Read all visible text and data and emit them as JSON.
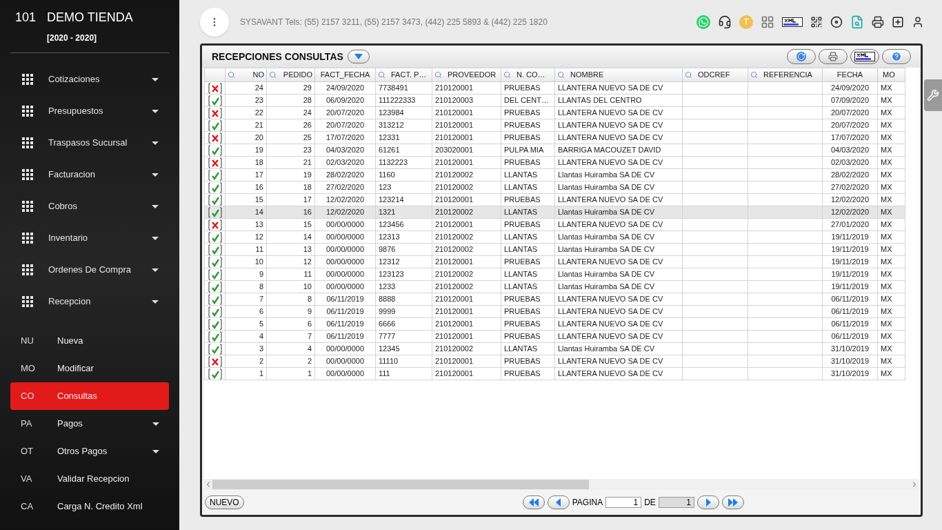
{
  "company": {
    "number": "101",
    "name": "DEMO TIENDA",
    "period": "[2020 - 2020]"
  },
  "menu": [
    {
      "label": "Cotizaciones"
    },
    {
      "label": "Presupuestos"
    },
    {
      "label": "Traspasos Sucursal"
    },
    {
      "label": "Facturacion"
    },
    {
      "label": "Cobros"
    },
    {
      "label": "Inventario"
    },
    {
      "label": "Ordenes De Compra"
    },
    {
      "label": "Recepcion"
    }
  ],
  "submenu": [
    {
      "abbr": "NU",
      "label": "Nueva",
      "selected": false,
      "has_caret": false
    },
    {
      "abbr": "MO",
      "label": "Modificar",
      "selected": false,
      "has_caret": false
    },
    {
      "abbr": "CO",
      "label": "Consultas",
      "selected": true,
      "has_caret": false
    },
    {
      "abbr": "PA",
      "label": "Pagos",
      "selected": false,
      "has_caret": true
    },
    {
      "abbr": "OT",
      "label": "Otros Pagos",
      "selected": false,
      "has_caret": true
    },
    {
      "abbr": "VA",
      "label": "Validar Recepcion",
      "selected": false,
      "has_caret": false
    },
    {
      "abbr": "CA",
      "label": "Carga N. Credito Xml",
      "selected": false,
      "has_caret": false
    }
  ],
  "topbar": {
    "contact": "SYSAVANT Tels: (55) 2157 3211, (55) 2157 3473, (442) 225 5893 & (442) 225 1820",
    "user_initial": "T"
  },
  "panel": {
    "title": "RECEPCIONES CONSULTAS"
  },
  "table": {
    "columns": [
      {
        "label": "NO",
        "filterable": true
      },
      {
        "label": "PEDIDO",
        "filterable": true
      },
      {
        "label": "FACT_FECHA",
        "filterable": false
      },
      {
        "label": "FACT. P…",
        "filterable": true
      },
      {
        "label": "PROVEEDOR",
        "filterable": true
      },
      {
        "label": "N. CO…",
        "filterable": true
      },
      {
        "label": "NOMBRE",
        "filterable": true
      },
      {
        "label": "ODCREF",
        "filterable": true
      },
      {
        "label": "REFERENCIA",
        "filterable": true
      },
      {
        "label": "FECHA",
        "filterable": false
      },
      {
        "label": "MO",
        "filterable": false
      }
    ],
    "rows": [
      {
        "kind": "cancel",
        "selected": false,
        "cells": [
          "24",
          "29",
          "24/09/2020",
          "7738491",
          "210120001",
          "PRUEBAS",
          "LLANTERA NUEVO SA DE CV",
          "",
          "",
          "24/09/2020",
          "MX"
        ]
      },
      {
        "kind": "ok",
        "selected": false,
        "cells": [
          "23",
          "28",
          "06/09/2020",
          "111222333",
          "210120003",
          "DEL CENT…",
          "LLANTAS DEL CENTRO",
          "",
          "",
          "07/09/2020",
          "MX"
        ]
      },
      {
        "kind": "cancel",
        "selected": false,
        "cells": [
          "22",
          "24",
          "20/07/2020",
          "123984",
          "210120001",
          "PRUEBAS",
          "LLANTERA NUEVO SA DE CV",
          "",
          "",
          "20/07/2020",
          "MX"
        ]
      },
      {
        "kind": "ok",
        "selected": false,
        "cells": [
          "21",
          "26",
          "20/07/2020",
          "313212",
          "210120001",
          "PRUEBAS",
          "LLANTERA NUEVO SA DE CV",
          "",
          "",
          "20/07/2020",
          "MX"
        ]
      },
      {
        "kind": "cancel",
        "selected": false,
        "cells": [
          "20",
          "25",
          "17/07/2020",
          "12331",
          "210120001",
          "PRUEBAS",
          "LLANTERA NUEVO SA DE CV",
          "",
          "",
          "17/07/2020",
          "MX"
        ]
      },
      {
        "kind": "ok",
        "selected": false,
        "cells": [
          "19",
          "23",
          "04/03/2020",
          "61261",
          "203020001",
          "PULPA MIA",
          "BARRIGA MACOUZET DAVID",
          "",
          "",
          "04/03/2020",
          "MX"
        ]
      },
      {
        "kind": "cancel",
        "selected": false,
        "cells": [
          "18",
          "21",
          "02/03/2020",
          "1132223",
          "210120001",
          "PRUEBAS",
          "LLANTERA NUEVO SA DE CV",
          "",
          "",
          "02/03/2020",
          "MX"
        ]
      },
      {
        "kind": "ok",
        "selected": false,
        "cells": [
          "17",
          "19",
          "28/02/2020",
          "1160",
          "210120002",
          "LLANTAS",
          "Llantas Huiramba SA DE CV",
          "",
          "",
          "28/02/2020",
          "MX"
        ]
      },
      {
        "kind": "ok",
        "selected": false,
        "cells": [
          "16",
          "18",
          "27/02/2020",
          "123",
          "210120002",
          "LLANTAS",
          "Llantas Huiramba SA DE CV",
          "",
          "",
          "27/02/2020",
          "MX"
        ]
      },
      {
        "kind": "ok",
        "selected": false,
        "cells": [
          "15",
          "17",
          "12/02/2020",
          "123214",
          "210120001",
          "PRUEBAS",
          "LLANTERA NUEVO SA DE CV",
          "",
          "",
          "12/02/2020",
          "MX"
        ]
      },
      {
        "kind": "ok",
        "selected": true,
        "cells": [
          "14",
          "16",
          "12/02/2020",
          "1321",
          "210120002",
          "LLANTAS",
          "Llantas Huiramba SA DE CV",
          "",
          "",
          "12/02/2020",
          "MX"
        ]
      },
      {
        "kind": "cancel",
        "selected": false,
        "cells": [
          "13",
          "15",
          "00/00/0000",
          "123456",
          "210120001",
          "PRUEBAS",
          "LLANTERA NUEVO SA DE CV",
          "",
          "",
          "27/01/2020",
          "MX"
        ]
      },
      {
        "kind": "ok",
        "selected": false,
        "cells": [
          "12",
          "14",
          "00/00/0000",
          "12313",
          "210120002",
          "LLANTAS",
          "Llantas Huiramba SA DE CV",
          "",
          "",
          "19/11/2019",
          "MX"
        ]
      },
      {
        "kind": "ok",
        "selected": false,
        "cells": [
          "11",
          "13",
          "00/00/0000",
          "9876",
          "210120002",
          "LLANTAS",
          "Llantas Huiramba SA DE CV",
          "",
          "",
          "19/11/2019",
          "MX"
        ]
      },
      {
        "kind": "ok",
        "selected": false,
        "cells": [
          "10",
          "12",
          "00/00/0000",
          "12312",
          "210120001",
          "PRUEBAS",
          "LLANTERA NUEVO SA DE CV",
          "",
          "",
          "19/11/2019",
          "MX"
        ]
      },
      {
        "kind": "ok",
        "selected": false,
        "cells": [
          "9",
          "11",
          "00/00/0000",
          "123123",
          "210120002",
          "LLANTAS",
          "Llantas Huiramba SA DE CV",
          "",
          "",
          "19/11/2019",
          "MX"
        ]
      },
      {
        "kind": "ok",
        "selected": false,
        "cells": [
          "8",
          "10",
          "00/00/0000",
          "1233",
          "210120002",
          "LLANTAS",
          "Llantas Huiramba SA DE CV",
          "",
          "",
          "19/11/2019",
          "MX"
        ]
      },
      {
        "kind": "ok",
        "selected": false,
        "cells": [
          "7",
          "8",
          "06/11/2019",
          "8888",
          "210120001",
          "PRUEBAS",
          "LLANTERA NUEVO SA DE CV",
          "",
          "",
          "06/11/2019",
          "MX"
        ]
      },
      {
        "kind": "ok",
        "selected": false,
        "cells": [
          "6",
          "9",
          "06/11/2019",
          "9999",
          "210120001",
          "PRUEBAS",
          "LLANTERA NUEVO SA DE CV",
          "",
          "",
          "06/11/2019",
          "MX"
        ]
      },
      {
        "kind": "ok",
        "selected": false,
        "cells": [
          "5",
          "6",
          "06/11/2019",
          "6666",
          "210120001",
          "PRUEBAS",
          "LLANTERA NUEVO SA DE CV",
          "",
          "",
          "06/11/2019",
          "MX"
        ]
      },
      {
        "kind": "ok",
        "selected": false,
        "cells": [
          "4",
          "7",
          "06/11/2019",
          "7777",
          "210120001",
          "PRUEBAS",
          "LLANTERA NUEVO SA DE CV",
          "",
          "",
          "06/11/2019",
          "MX"
        ]
      },
      {
        "kind": "ok",
        "selected": false,
        "cells": [
          "3",
          "4",
          "00/00/0000",
          "12345",
          "210120002",
          "LLANTAS",
          "Llantas Huiramba SA DE CV",
          "",
          "",
          "31/10/2019",
          "MX"
        ]
      },
      {
        "kind": "cancel",
        "selected": false,
        "cells": [
          "2",
          "2",
          "00/00/0000",
          "11110",
          "210120001",
          "PRUEBAS",
          "LLANTERA NUEVO SA DE CV",
          "",
          "",
          "31/10/2019",
          "MX"
        ]
      },
      {
        "kind": "ok",
        "selected": false,
        "cells": [
          "1",
          "1",
          "00/00/0000",
          "111",
          "210120001",
          "PRUEBAS",
          "LLANTERA NUEVO SA DE CV",
          "",
          "",
          "31/10/2019",
          "MX"
        ]
      }
    ]
  },
  "footer": {
    "new_button": "NUEVO",
    "page_label": "PAGINA",
    "page": "1",
    "of_label": "DE",
    "total_pages": "1"
  }
}
